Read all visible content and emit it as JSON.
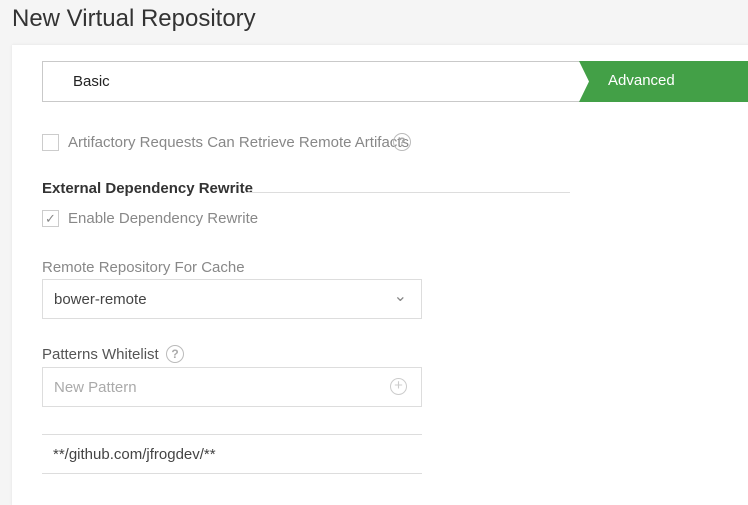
{
  "page_title": "New Virtual Repository",
  "wizard": {
    "steps": [
      "Basic",
      "Advanced"
    ],
    "active": "Advanced"
  },
  "artifactory_requests": {
    "label": "Artifactory Requests Can Retrieve Remote Artifacts",
    "checked": false
  },
  "external_dependency": {
    "heading": "External Dependency Rewrite",
    "enable_label": "Enable Dependency Rewrite",
    "enabled": true
  },
  "remote_cache": {
    "label": "Remote Repository For Cache",
    "value": "bower-remote"
  },
  "patterns": {
    "label": "Patterns Whitelist",
    "placeholder": "New Pattern",
    "items": [
      "**/github.com/jfrogdev/**"
    ]
  },
  "icons": {
    "help": "?",
    "check": "✓",
    "chevron": "⌄",
    "plus": "+"
  },
  "colors": {
    "accent": "#43a047"
  }
}
